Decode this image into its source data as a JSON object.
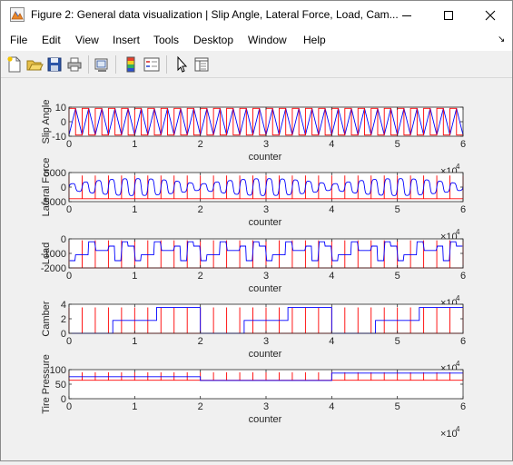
{
  "window": {
    "title": "Figure 2: General data visualization | Slip Angle, Lateral Force, Load, Cam...",
    "app_icon": "matlab-figure-icon",
    "controls": {
      "minimize": "minimize-icon",
      "maximize": "maximize-icon",
      "close": "close-icon"
    }
  },
  "menu": {
    "items": [
      "File",
      "Edit",
      "View",
      "Insert",
      "Tools",
      "Desktop",
      "Window",
      "Help"
    ],
    "overflow_icon": "dock-arrow-icon",
    "overflow_glyph": "↘"
  },
  "toolbar": {
    "buttons": [
      {
        "name": "new-figure-icon"
      },
      {
        "name": "open-file-icon"
      },
      {
        "name": "save-icon"
      },
      {
        "name": "print-icon"
      },
      {
        "name": "link-plot-icon"
      },
      {
        "name": "colorbar-icon"
      },
      {
        "name": "legend-icon"
      },
      {
        "name": "edit-plot-pointer-icon"
      },
      {
        "name": "property-inspector-icon"
      }
    ]
  },
  "colors": {
    "series1": "#0000ff",
    "series2": "#ff0000",
    "axes": "#262626",
    "background": "#f0f0f0",
    "plot_bg": "#ffffff"
  },
  "chart_data": [
    {
      "type": "line",
      "ylabel": "Slip Angle",
      "xlabel": "counter",
      "xlim": [
        0,
        60000
      ],
      "ylim": [
        -12,
        12
      ],
      "x_ticks": [
        "0",
        "1",
        "2",
        "3",
        "4",
        "5",
        "6"
      ],
      "y_ticks": [
        "-10",
        "0",
        "10"
      ],
      "exponent_label": "×10",
      "exponent_power": "4",
      "series": [
        {
          "color": "#0000ff",
          "kind": "sawtooth",
          "amplitude": 11,
          "cycles": 30
        },
        {
          "color": "#ff0000",
          "kind": "square",
          "levels": [
            -11,
            11
          ],
          "cycles": 30
        }
      ]
    },
    {
      "type": "line",
      "ylabel": "Lateral Force",
      "xlabel": "counter",
      "xlim": [
        0,
        60000
      ],
      "ylim": [
        -5000,
        5000
      ],
      "x_ticks": [
        "0",
        "1",
        "2",
        "3",
        "4",
        "5",
        "6"
      ],
      "y_ticks": [
        "-5000",
        "0",
        "5000"
      ],
      "exponent_label": "×10",
      "exponent_power": "4",
      "series": [
        {
          "color": "#ff0000",
          "kind": "spikes",
          "levels": [
            -4000,
            4000
          ],
          "cycles": 30
        },
        {
          "color": "#0000ff",
          "kind": "wave",
          "amplitude": 3000,
          "cycles": 30
        }
      ]
    },
    {
      "type": "line",
      "ylabel": "Load",
      "xlabel": "counter",
      "xlim": [
        0,
        60000
      ],
      "ylim": [
        -2000,
        0
      ],
      "x_ticks": [
        "0",
        "1",
        "2",
        "3",
        "4",
        "5",
        "6"
      ],
      "y_ticks": [
        "-2000",
        "-1000",
        "0"
      ],
      "exponent_label": "×10",
      "exponent_power": "4",
      "series": [
        {
          "color": "#ff0000",
          "kind": "spikes",
          "levels": [
            -2000,
            -100
          ],
          "cycles": 30
        },
        {
          "color": "#0000ff",
          "kind": "steps",
          "levels": [
            -1500,
            -1100,
            -800,
            -500,
            -200
          ],
          "cycles": 30
        }
      ]
    },
    {
      "type": "line",
      "ylabel": "Camber",
      "xlabel": "counter",
      "xlim": [
        0,
        60000
      ],
      "ylim": [
        0,
        4.5
      ],
      "x_ticks": [
        "0",
        "1",
        "2",
        "3",
        "4",
        "5",
        "6"
      ],
      "y_ticks": [
        "0",
        "2",
        "4"
      ],
      "exponent_label": "×10",
      "exponent_power": "4",
      "series": [
        {
          "color": "#ff0000",
          "kind": "spikes",
          "levels": [
            0,
            4
          ],
          "cycles": 30
        },
        {
          "color": "#0000ff",
          "kind": "levels",
          "sequence": [
            0,
            2,
            4,
            0,
            2,
            4,
            0,
            2,
            4
          ],
          "segment_length": 6667
        }
      ]
    },
    {
      "type": "line",
      "ylabel": "Tire Pressure",
      "xlabel": "counter",
      "xlim": [
        0,
        60000
      ],
      "ylim": [
        0,
        110
      ],
      "x_ticks": [
        "0",
        "1",
        "2",
        "3",
        "4",
        "5",
        "6"
      ],
      "y_ticks": [
        "0",
        "50",
        "100"
      ],
      "exponent_label": "×10",
      "exponent_power": "4",
      "series": [
        {
          "color": "#ff0000",
          "kind": "spikes",
          "levels": [
            70,
            100
          ],
          "cycles": 30
        },
        {
          "color": "#0000ff",
          "kind": "levels",
          "sequence": [
            83,
            69,
            97
          ],
          "segment_length": 20000
        }
      ]
    }
  ]
}
